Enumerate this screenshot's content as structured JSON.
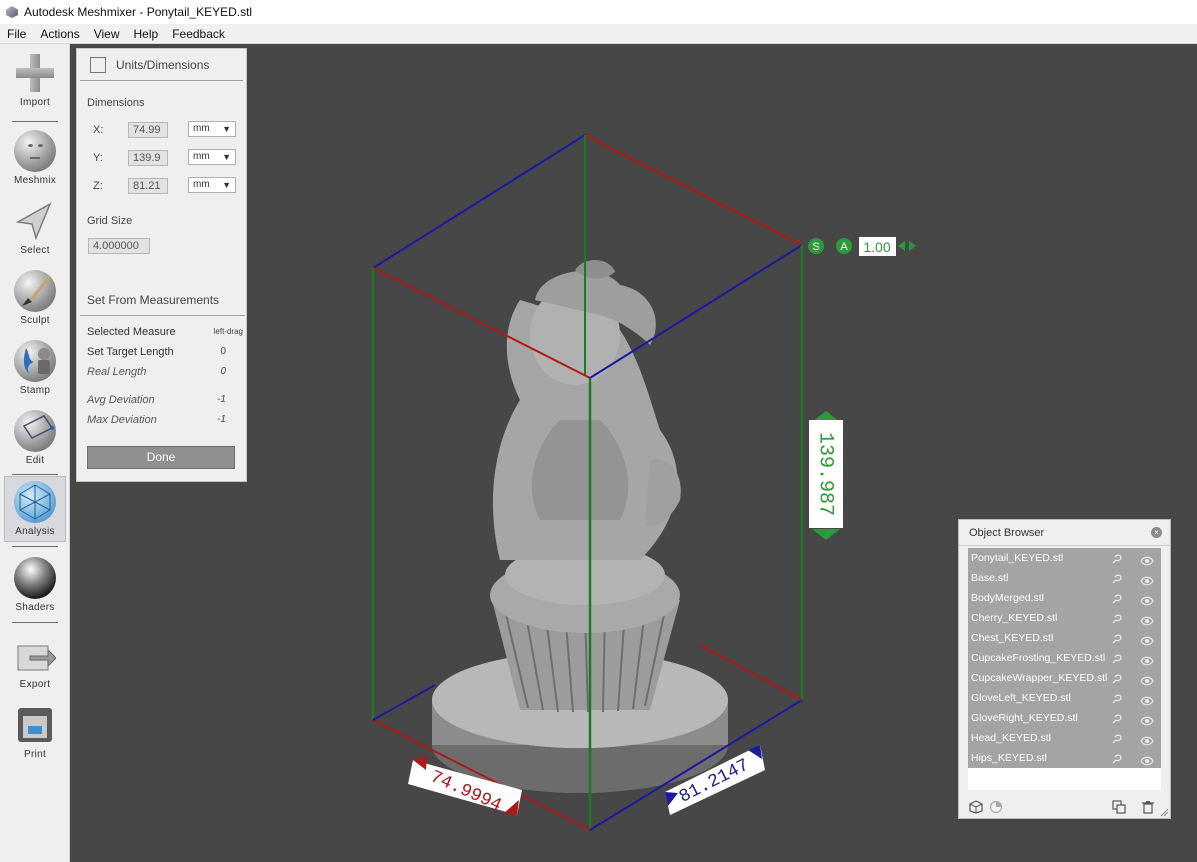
{
  "window": {
    "title": "Autodesk Meshmixer - Ponytail_KEYED.stl"
  },
  "menu": [
    "File",
    "Actions",
    "View",
    "Help",
    "Feedback"
  ],
  "toolbar": {
    "items": [
      {
        "label": "Import",
        "icon": "import-icon"
      },
      {
        "label": "Meshmix",
        "icon": "meshmix-icon"
      },
      {
        "label": "Select",
        "icon": "select-icon"
      },
      {
        "label": "Sculpt",
        "icon": "sculpt-icon"
      },
      {
        "label": "Stamp",
        "icon": "stamp-icon"
      },
      {
        "label": "Edit",
        "icon": "edit-icon"
      },
      {
        "label": "Analysis",
        "icon": "analysis-icon",
        "active": true
      },
      {
        "label": "Shaders",
        "icon": "shaders-icon"
      },
      {
        "label": "Export",
        "icon": "export-icon"
      },
      {
        "label": "Print",
        "icon": "print-icon"
      }
    ]
  },
  "units_panel": {
    "title": "Units/Dimensions",
    "dimensions_label": "Dimensions",
    "x": {
      "label": "X:",
      "value": "74.99",
      "unit": "mm"
    },
    "y": {
      "label": "Y:",
      "value": "139.9",
      "unit": "mm"
    },
    "z": {
      "label": "Z:",
      "value": "81.21",
      "unit": "mm"
    },
    "grid_size_label": "Grid Size",
    "grid_size_value": "4.000000",
    "set_from_measurements": "Set From Measurements",
    "selected_measure": {
      "label": "Selected Measure",
      "value": "left-drag"
    },
    "set_target_length": {
      "label": "Set Target Length",
      "value": "0"
    },
    "real_length": {
      "label": "Real Length",
      "value": "0"
    },
    "avg_deviation": {
      "label": "Avg Deviation",
      "value": "-1"
    },
    "max_deviation": {
      "label": "Max Deviation",
      "value": "-1"
    },
    "done": "Done"
  },
  "viewport": {
    "scale_s": "S",
    "scale_a": "A",
    "scale_value": "1.00",
    "dim_x": "74.9994",
    "dim_y": "139.987",
    "dim_z": "81.2147"
  },
  "object_browser": {
    "title": "Object Browser",
    "objects": [
      "Ponytail_KEYED.stl",
      "Base.stl",
      "BodyMerged.stl",
      "Cherry_KEYED.stl",
      "Chest_KEYED.stl",
      "CupcakeFrosting_KEYED.stl",
      "CupcakeWrapper_KEYED.stl",
      "GloveLeft_KEYED.stl",
      "GloveRight_KEYED.stl",
      "Head_KEYED.stl",
      "Hips_KEYED.stl"
    ]
  }
}
